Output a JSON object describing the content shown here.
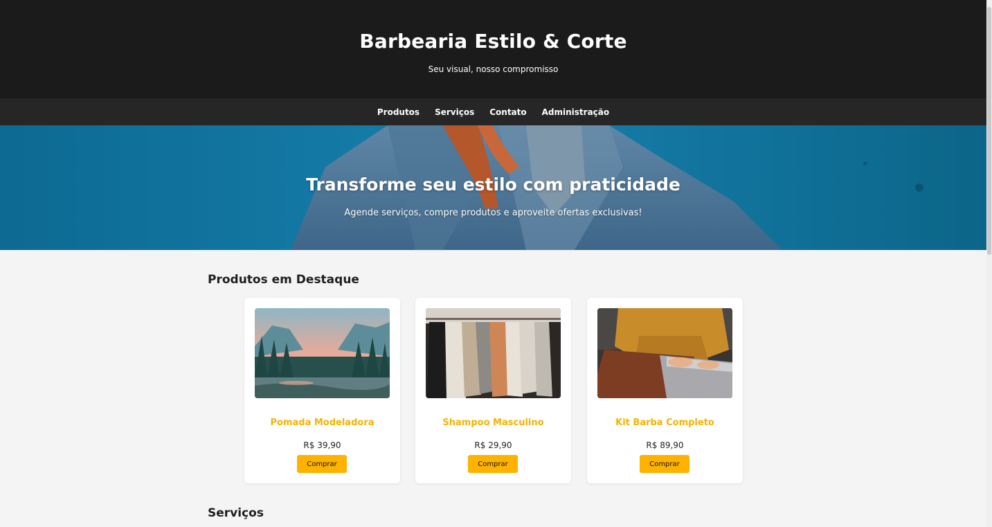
{
  "header": {
    "title": "Barbearia Estilo & Corte",
    "subtitle": "Seu visual, nosso compromisso"
  },
  "nav": {
    "items": [
      {
        "label": "Produtos"
      },
      {
        "label": "Serviços"
      },
      {
        "label": "Contato"
      },
      {
        "label": "Administração"
      }
    ]
  },
  "hero": {
    "title": "Transforme seu estilo com praticidade",
    "subtitle": "Agende serviços, compre produtos e aproveite ofertas exclusivas!"
  },
  "products_section": {
    "title": "Produtos em Destaque",
    "items": [
      {
        "name": "Pomada Modeladora",
        "price": "R$ 39,90",
        "button": "Comprar",
        "image": "mountain-lake-photo"
      },
      {
        "name": "Shampoo Masculino",
        "price": "R$ 29,90",
        "button": "Comprar",
        "image": "clothing-rack-photo"
      },
      {
        "name": "Kit Barba Completo",
        "price": "R$ 89,90",
        "button": "Comprar",
        "image": "laptop-sweater-photo"
      }
    ]
  },
  "services_section": {
    "title": "Serviços"
  },
  "colors": {
    "header_bg": "#1b1b1b",
    "nav_bg": "#262626",
    "accent": "#ffb300",
    "product_name": "#f5b301",
    "page_bg": "#f4f4f4"
  }
}
